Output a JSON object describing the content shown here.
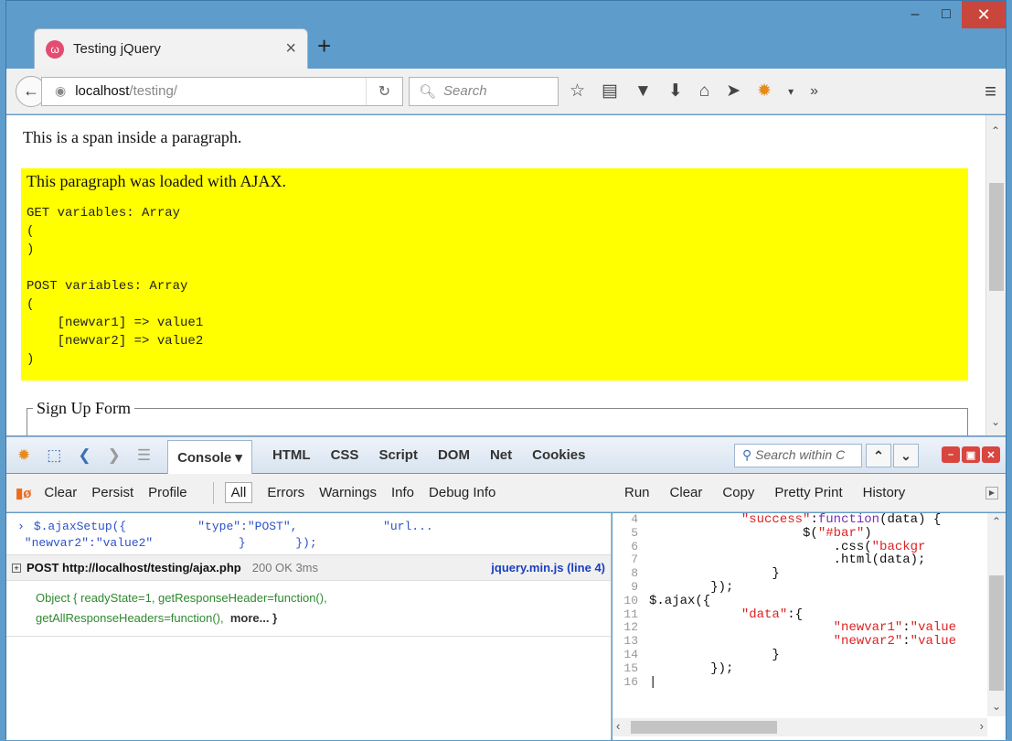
{
  "browser": {
    "tab_title": "Testing jQuery",
    "url_host": "localhost",
    "url_path": "/testing/",
    "search_placeholder": "Search"
  },
  "page": {
    "span_text": "This is a span inside a paragraph.",
    "ajax_title": "This paragraph was loaded with AJAX.",
    "ajax_output": "GET variables: Array\n(\n)\n\nPOST variables: Array\n(\n    [newvar1] => value1\n    [newvar2] => value2\n)",
    "fieldset_legend": "Sign Up Form"
  },
  "firebug": {
    "tabs": [
      "Console ▾",
      "HTML",
      "CSS",
      "Script",
      "DOM",
      "Net",
      "Cookies"
    ],
    "search_placeholder": "Search within C",
    "console_toolbar": [
      "Clear",
      "Persist",
      "Profile"
    ],
    "filters": [
      "All",
      "Errors",
      "Warnings",
      "Info",
      "Debug Info"
    ],
    "editor_toolbar": [
      "Run",
      "Clear",
      "Copy",
      "Pretty Print",
      "History"
    ],
    "console_cmd": "$.ajaxSetup({          \"type\":\"POST\",            \"url...\n \"newvar2\":\"value2\"            }       });",
    "post_url": "POST http://localhost/testing/ajax.php",
    "post_status": "200 OK 3ms",
    "post_source": "jquery.min.js (line 4)",
    "object_line1": "Object {  readyState=1,  getResponseHeader=function(),",
    "object_line2": "getAllResponseHeaders=function(),",
    "object_more": "more... }",
    "line_numbers": "4\n5\n6\n7\n8\n9\n10\n11\n12\n13\n14\n15\n16"
  }
}
